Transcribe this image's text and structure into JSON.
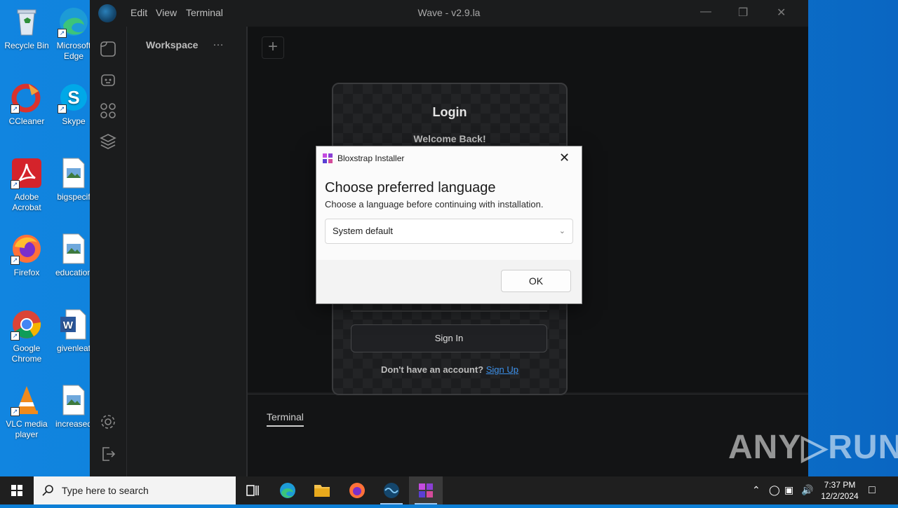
{
  "desktop": {
    "icons": [
      {
        "label": "Recycle Bin"
      },
      {
        "label": "Microsoft Edge"
      },
      {
        "label": "CCleaner"
      },
      {
        "label": "Skype"
      },
      {
        "label": "Adobe Acrobat"
      },
      {
        "label": "bigspecif"
      },
      {
        "label": "Firefox"
      },
      {
        "label": "education"
      },
      {
        "label": "Google Chrome"
      },
      {
        "label": "givenleat"
      },
      {
        "label": "VLC media player"
      },
      {
        "label": "increased"
      }
    ]
  },
  "wave": {
    "menu": [
      "Edit",
      "View",
      "Terminal"
    ],
    "title": "Wave - v2.9.la",
    "workspace_title": "Workspace",
    "workspace_more": "…",
    "add_tab": "+",
    "terminal_label": "Terminal"
  },
  "login": {
    "title": "Login",
    "welcome": "Welcome Back!",
    "signin_label": "Sign In",
    "no_account": "Don't have an account?",
    "signup_label": "Sign Up"
  },
  "dialog": {
    "app_name": "Bloxstrap Installer",
    "heading": "Choose preferred language",
    "subtext": "Choose a language before continuing with installation.",
    "selected_language": "System default",
    "ok_label": "OK",
    "close_glyph": "✕"
  },
  "watermark": {
    "text": "ANY▷RUN"
  },
  "taskbar": {
    "search_placeholder": "Type here to search",
    "time": "7:37 PM",
    "date": "12/2/2024"
  },
  "colors": {
    "desktop_blue": "#0d7fd6",
    "wave_bg": "#1b1c1d",
    "link_blue": "#3b8fe8",
    "taskbar": "#1f1f1f"
  }
}
